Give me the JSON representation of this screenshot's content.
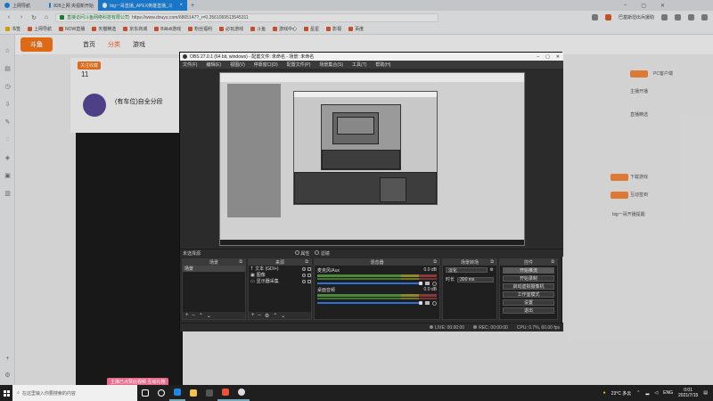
{
  "browser": {
    "tabs": [
      {
        "label": "上网导航",
        "active": false
      },
      {
        "label": "828上网 央视新开始",
        "active": false
      },
      {
        "label": "big一哥直播_APEX英雄直播_斗鱼直",
        "active": true
      }
    ],
    "url_host": "直接访问斗鱼网络科技有限公司",
    "url_path": "https://www.douyu.com/6865147?_r=0.3561069513545311",
    "addr_right": "巴基斯坦出兵援助",
    "bookmarks": [
      "书签",
      "上网导航",
      "NOW直播",
      "天猫精选",
      "京东商城",
      "Bilibili游戏",
      "粉丝福利",
      "必玩游戏",
      "斗鱼",
      "游戏中心",
      "星星",
      "影视",
      "百度"
    ]
  },
  "douyu": {
    "logo": "斗鱼",
    "nav": [
      {
        "label": "首页",
        "active": false
      },
      {
        "label": "分类",
        "active": true
      },
      {
        "label": "游戏",
        "active": false
      }
    ],
    "badge": "关注收藏",
    "count": "11",
    "anchor_title": "(有车位)自全分段",
    "right_items": [
      "PC客户端",
      "主播开播",
      "直播精选",
      "下载游戏",
      "互动签到",
      "big一哥开播提醒"
    ],
    "toast": "主播已点赞此视频 互动礼物"
  },
  "obs": {
    "title": "OBS 27.0.1 (64 bit, windows) - 配置文件: 未命名 - 场景: 未命名",
    "menu": [
      "文件(F)",
      "编辑(E)",
      "视图(V)",
      "停靠窗口(D)",
      "配置文件(P)",
      "场景集合(S)",
      "工具(T)",
      "帮助(H)"
    ],
    "toolbar_label": "未选择源",
    "toolbar_buttons": [
      "属性",
      "滤镜"
    ],
    "docks": {
      "scenes": {
        "title": "场景",
        "items": [
          "场景"
        ]
      },
      "sources": {
        "title": "来源",
        "items": [
          "文本 (GDI+)",
          "图像",
          "显示器采集"
        ]
      },
      "mixer": {
        "title": "混音器",
        "channels": [
          {
            "name": "麦克风/Aux",
            "level": "0.0 dB"
          },
          {
            "name": "桌面音频",
            "level": "0.0 dB"
          }
        ]
      },
      "transitions": {
        "title": "场景转场",
        "type": "淡化",
        "duration_label": "时长",
        "duration_value": "300 ms"
      },
      "controls": {
        "title": "控件",
        "buttons": [
          "开始推流",
          "开始录制",
          "启动虚拟摄像机",
          "工作室模式",
          "设置",
          "退出"
        ]
      }
    },
    "status": {
      "live": "LIVE: 00:00:00",
      "rec": "REC: 00:00:00",
      "cpu": "CPU: 0.7%, 60.00 fps"
    }
  },
  "taskbar": {
    "search_placeholder": "在这里输入你要搜索的内容",
    "weather": "23°C 多云",
    "lang": "ENG",
    "time": "0:01",
    "date": "2021/7/15"
  },
  "colors": {
    "browser_tab_active": "#1e88e5",
    "douyu_accent": "#ff5d23",
    "obs_bg": "#2b2b2b",
    "meter_green": "#4a8a3a",
    "slider_blue": "#2f6fd6"
  }
}
